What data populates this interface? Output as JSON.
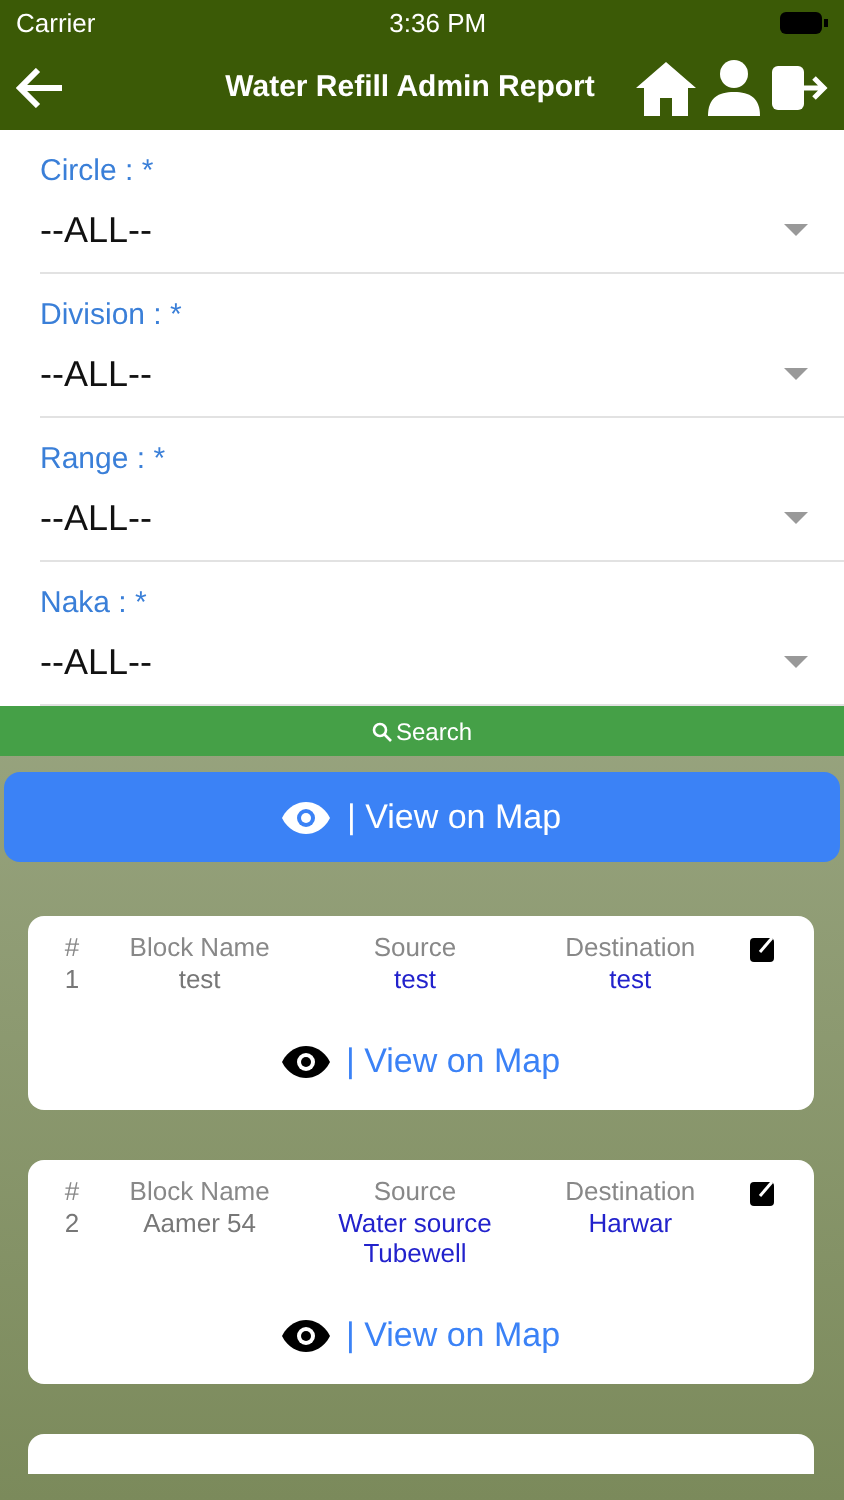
{
  "status_bar": {
    "carrier": "Carrier",
    "time": "3:36 PM"
  },
  "nav": {
    "title": "Water Refill Admin Report"
  },
  "filters": [
    {
      "label": "Circle : *",
      "value": "--ALL--"
    },
    {
      "label": "Division : *",
      "value": "--ALL--"
    },
    {
      "label": "Range : *",
      "value": "--ALL--"
    },
    {
      "label": "Naka : *",
      "value": "--ALL--"
    }
  ],
  "search_button": "Search",
  "map_button": "| View on Map",
  "records": [
    {
      "columns": [
        "#",
        "Block Name",
        "Source",
        "Destination"
      ],
      "number": "1",
      "block_name": "test",
      "source": [
        "test"
      ],
      "destination": "test",
      "map_link": "| View on Map"
    },
    {
      "columns": [
        "#",
        "Block Name",
        "Source",
        "Destination"
      ],
      "number": "2",
      "block_name": "Aamer 54",
      "source": [
        "Water source",
        "Tubewell"
      ],
      "destination": "Harwar",
      "map_link": "| View on Map"
    }
  ],
  "more_records_below": true
}
